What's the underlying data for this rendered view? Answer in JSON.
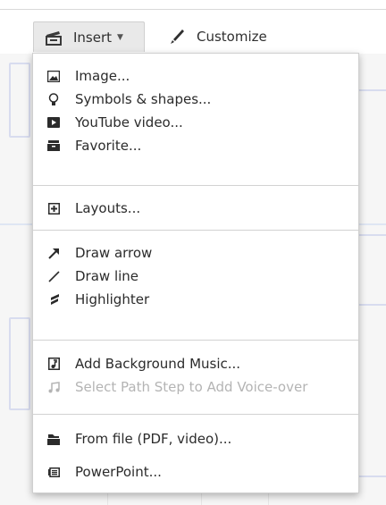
{
  "toolbar": {
    "insert_label": "Insert",
    "customize_label": "Customize"
  },
  "menu": {
    "groups": [
      {
        "items": [
          {
            "label": "Image...",
            "icon": "image-icon",
            "disabled": false
          },
          {
            "label": "Symbols & shapes...",
            "icon": "lightbulb-icon",
            "disabled": false
          },
          {
            "label": "YouTube video...",
            "icon": "play-icon",
            "disabled": false
          },
          {
            "label": "Favorite...",
            "icon": "favorite-box-icon",
            "disabled": false
          }
        ]
      },
      {
        "items": [
          {
            "label": "Layouts...",
            "icon": "plus-box-icon",
            "disabled": false
          }
        ]
      },
      {
        "items": [
          {
            "label": "Draw arrow",
            "icon": "arrow-icon",
            "disabled": false
          },
          {
            "label": "Draw line",
            "icon": "line-icon",
            "disabled": false
          },
          {
            "label": "Highlighter",
            "icon": "highlighter-icon",
            "disabled": false
          }
        ]
      },
      {
        "items": [
          {
            "label": "Add Background Music...",
            "icon": "music-file-icon",
            "disabled": false
          },
          {
            "label": "Select Path Step to Add Voice-over",
            "icon": "music-note-icon",
            "disabled": true
          }
        ]
      },
      {
        "items": [
          {
            "label": "From file (PDF, video)...",
            "icon": "folder-icon",
            "disabled": false
          },
          {
            "label": "PowerPoint...",
            "icon": "powerpoint-icon",
            "disabled": false
          }
        ]
      }
    ]
  },
  "colors": {
    "text": "#2b2b2b",
    "disabled_text": "#b4b4b4",
    "button_bg": "#e9e9e9",
    "separator": "#d2d2d2"
  }
}
